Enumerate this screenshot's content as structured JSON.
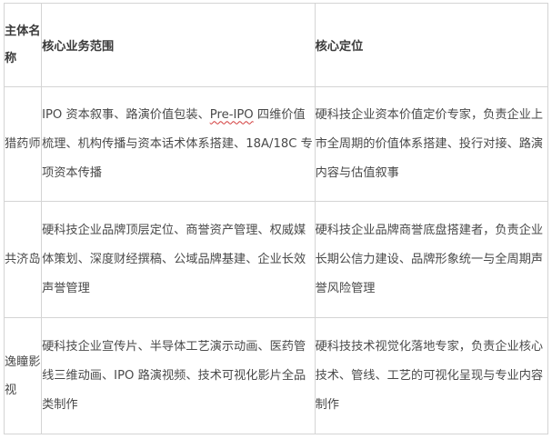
{
  "headers": {
    "name": "主体名称",
    "scope": "核心业务范围",
    "position": "核心定位"
  },
  "rows": [
    {
      "name": "猎药师",
      "scope_pre": "IPO 资本叙事、路演价值包装、",
      "scope_marked": "Pre-IPO",
      "scope_post": " 四维价值梳理、机构传播与资本话术体系搭建、18A/18C 专项资本传播",
      "position": "硬科技企业资本价值定价专家，负责企业上市全周期的价值体系搭建、投行对接、路演内容与估值叙事"
    },
    {
      "name": "共济岛",
      "scope": "硬科技企业品牌顶层定位、商誉资产管理、权威媒体策划、深度财经撰稿、公域品牌基建、企业长效声誉管理",
      "position": "硬科技企业品牌商誉底盘搭建者，负责企业长期公信力建设、品牌形象统一与全周期声誉风险管理"
    },
    {
      "name": "逸瞳影视",
      "scope": "硬科技企业宣传片、半导体工艺演示动画、医药管线三维动画、IPO 路演视频、技术可视化影片全品类制作",
      "position": "硬科技技术视觉化落地专家，负责企业核心技术、管线、工艺的可视化呈现与专业内容制作"
    }
  ]
}
